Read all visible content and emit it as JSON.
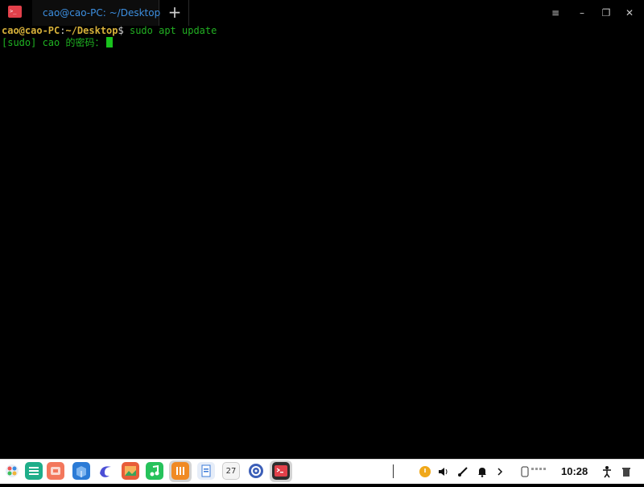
{
  "window": {
    "tab_title": "cao@cao-PC: ~/Desktop",
    "new_tab_symbol": "+",
    "menu_symbol": "≡",
    "minimize_symbol": "–",
    "restore_symbol": "❐",
    "close_symbol": "✕"
  },
  "terminal": {
    "line1": {
      "user_host": "cao@cao-PC",
      "colon": ":",
      "path": "~/Desktop",
      "dollar": "$",
      "command": " sudo apt update"
    },
    "line2": {
      "prompt_text": "[sudo] cao 的密码："
    }
  },
  "taskbar": {
    "icons": [
      "launcher-icon",
      "file-manager-icon",
      "app-store-icon",
      "package-icon",
      "browser-icon",
      "image-viewer-icon",
      "music-icon",
      "notes-icon",
      "document-viewer-icon",
      "calendar-icon",
      "settings-icon",
      "terminal-icon"
    ],
    "calendar_day": "27",
    "clock": "10:28",
    "colors": {
      "terminal_accent": "#e2404a",
      "prompt_yellow": "#d7b13a",
      "text_green": "#1fb322",
      "tab_title_blue": "#3c8fe0"
    }
  }
}
